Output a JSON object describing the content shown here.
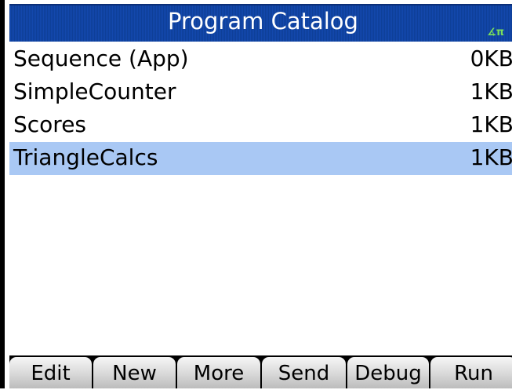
{
  "header": {
    "title": "Program Catalog",
    "angle_mode_indicator": "∡π"
  },
  "programs": [
    {
      "name": "Sequence (App)",
      "size": "0KB",
      "selected": false
    },
    {
      "name": "SimpleCounter",
      "size": "1KB",
      "selected": false
    },
    {
      "name": "Scores",
      "size": "1KB",
      "selected": false
    },
    {
      "name": "TriangleCalcs",
      "size": "1KB",
      "selected": true
    }
  ],
  "softkeys": {
    "edit": "Edit",
    "new": "New",
    "more": "More",
    "send": "Send",
    "debug": "Debug",
    "run": "Run"
  },
  "colors": {
    "title_bar": "#1348ad",
    "selection": "#a9c8f4",
    "angle_indicator": "#7be05a"
  }
}
